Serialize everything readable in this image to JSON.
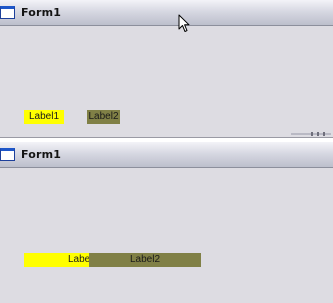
{
  "windows": [
    {
      "title": "Form1",
      "labels": [
        {
          "text": "Label1",
          "color": "#ffff00"
        },
        {
          "text": "Label2",
          "color": "#808046"
        }
      ]
    },
    {
      "title": "Form1",
      "labels": [
        {
          "text": "Label1",
          "visible_text": "Labe",
          "color": "#ffff00"
        },
        {
          "text": "Label2",
          "color": "#808046"
        }
      ]
    }
  ],
  "icons": {
    "window": "window-icon",
    "cursor": "mouse-pointer-icon"
  },
  "colors": {
    "titlebar": "#cfd1dc",
    "client": "#dddce2",
    "label_yellow": "#ffff00",
    "label_olive": "#808046"
  }
}
